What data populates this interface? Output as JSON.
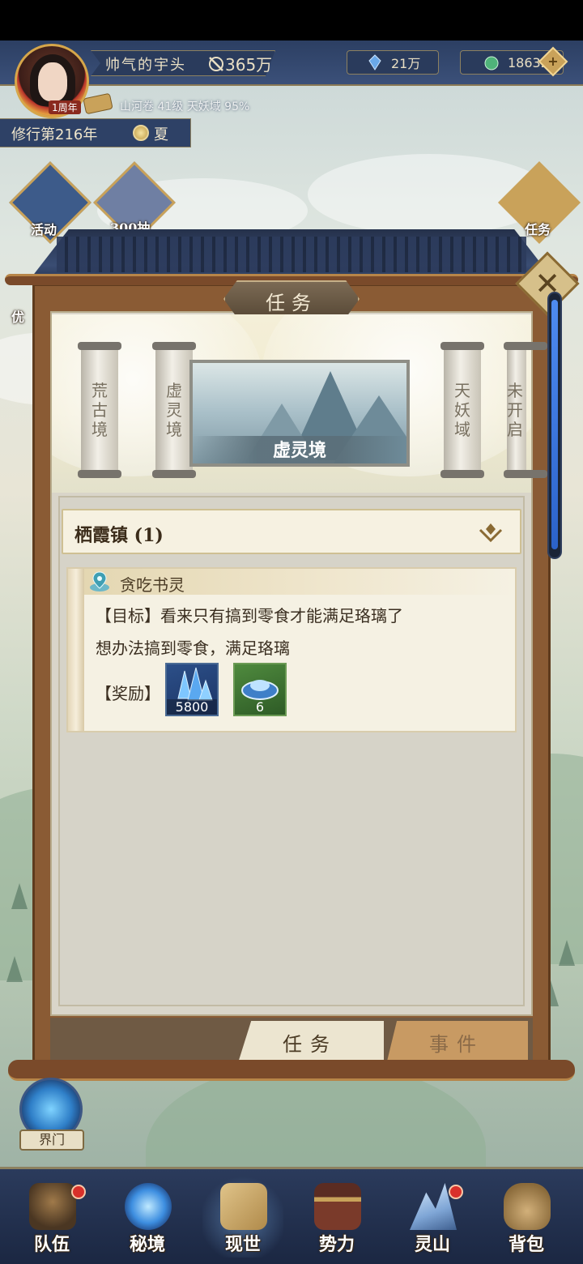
{
  "player": {
    "name": "帅气的宇头",
    "power": "365万",
    "anniversary_badge": "1周年",
    "map_info": "山河卷 41级 天妖域 95%"
  },
  "resources": {
    "crystal": "21万",
    "jade": "18632"
  },
  "cultivation": {
    "year": "修行第216年",
    "season": "夏"
  },
  "world_icons": {
    "activity": "活动",
    "character_count": "300抽",
    "task": "任务",
    "preferential": "优"
  },
  "panel": {
    "title": "任务",
    "close_symbol": "✕"
  },
  "regions": [
    {
      "name": "荒古境"
    },
    {
      "name": "虚灵境"
    },
    {
      "name": "天妖域"
    },
    {
      "name": "未开启"
    }
  ],
  "featured_region": "虚灵境",
  "group": {
    "title": "栖霞镇 (1)"
  },
  "task": {
    "title": "贪吃书灵",
    "goal_line": "【目标】看来只有搞到零食才能满足珞璃了",
    "desc_line": "想办法搞到零食，满足珞璃",
    "reward_label": "【奖励】",
    "rewards": [
      {
        "icon": "blue-crystal-icon",
        "count": "5800"
      },
      {
        "icon": "jade-ingot-icon",
        "count": "6"
      }
    ]
  },
  "tabs": {
    "tasks": "任务",
    "events": "事件"
  },
  "portal_label": "界门",
  "bottom_nav": [
    {
      "label": "队伍"
    },
    {
      "label": "秘境"
    },
    {
      "label": "现世"
    },
    {
      "label": "势力"
    },
    {
      "label": "灵山"
    },
    {
      "label": "背包"
    }
  ],
  "colors": {
    "navy": "#2b3b5c",
    "gold": "#c9a25a",
    "parchment": "#f5f1e3",
    "wood": "#8a5b34"
  }
}
